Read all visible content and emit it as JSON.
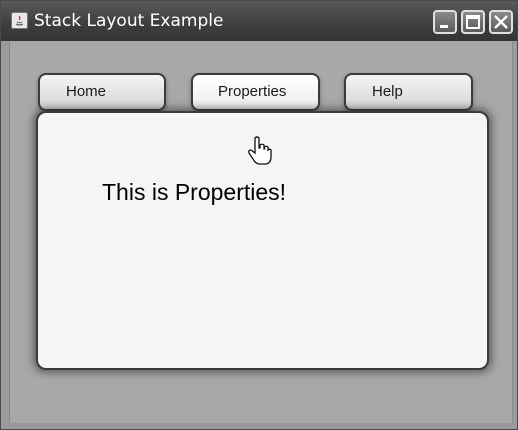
{
  "window": {
    "title": "Stack Layout Example"
  },
  "tabs": [
    {
      "label": "Home"
    },
    {
      "label": "Properties"
    },
    {
      "label": "Help"
    }
  ],
  "active_tab": "Properties",
  "content": {
    "text": "This is Properties!"
  },
  "colors": {
    "titlebar": "#3d3d3d",
    "client": "#a8a8a8",
    "panel": "#f5f5f5",
    "border": "#3b3b3b"
  }
}
